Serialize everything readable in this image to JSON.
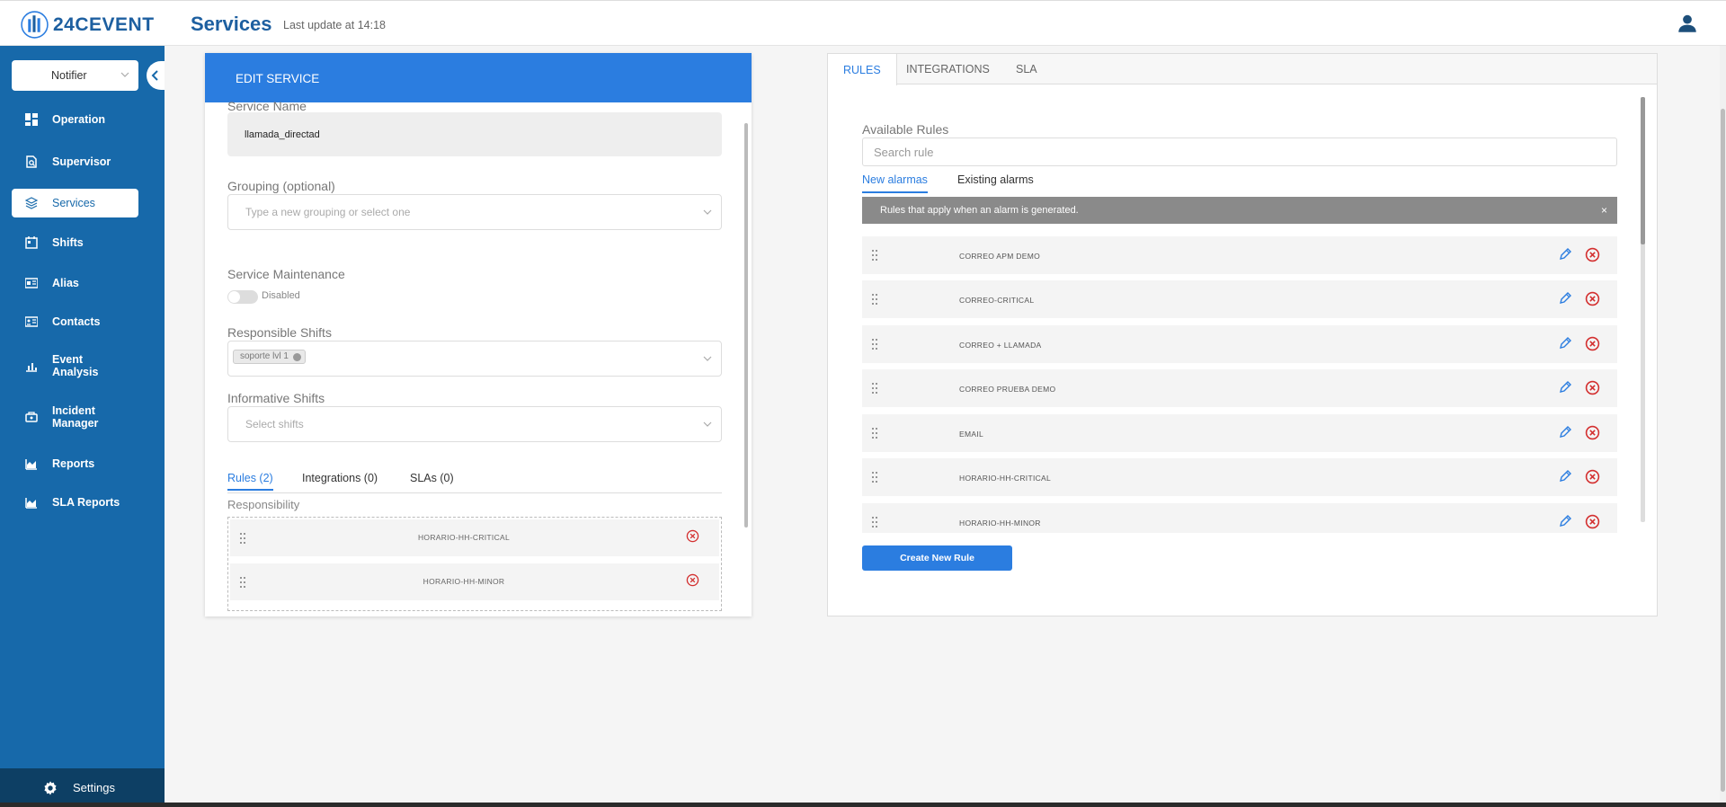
{
  "app": {
    "brand": "24CEVENT",
    "page_title": "Services",
    "last_update": "Last update at 14:18"
  },
  "sidebar": {
    "selector": "Notifier",
    "items": [
      {
        "label": "Operation",
        "icon": "dashboard-icon"
      },
      {
        "label": "Supervisor",
        "icon": "supervisor-icon"
      },
      {
        "label": "Services",
        "icon": "layers-icon",
        "active": true
      },
      {
        "label": "Shifts",
        "icon": "calendar-icon"
      },
      {
        "label": "Alias",
        "icon": "id-card-icon"
      },
      {
        "label": "Contacts",
        "icon": "contact-card-icon"
      },
      {
        "label": "Event Analysis",
        "line1": "Event",
        "line2": "Analysis",
        "icon": "bar-chart-icon"
      },
      {
        "label": "Incident Manager",
        "line1": "Incident",
        "line2": "Manager",
        "icon": "incident-icon"
      },
      {
        "label": "Reports",
        "icon": "area-chart-icon"
      },
      {
        "label": "SLA Reports",
        "icon": "area-chart-icon"
      }
    ],
    "settings": "Settings"
  },
  "edit_service": {
    "header": "EDIT SERVICE",
    "service_name_label": "Service Name",
    "service_name_value": "llamada_directad",
    "grouping_label": "Grouping (optional)",
    "grouping_placeholder": "Type a new grouping or select one",
    "maintenance_label": "Service Maintenance",
    "maintenance_state": "Disabled",
    "responsible_label": "Responsible Shifts",
    "responsible_chip": "soporte lvl 1",
    "informative_label": "Informative Shifts",
    "informative_placeholder": "Select shifts",
    "tabs": [
      "Rules (2)",
      "Integrations (0)",
      "SLAs (0)"
    ],
    "responsibility_label": "Responsibility",
    "assigned_rules": [
      "HORARIO-HH-CRITICAL",
      "HORARIO-HH-MINOR"
    ]
  },
  "rules_panel": {
    "tabs": [
      "RULES",
      "INTEGRATIONS",
      "SLA"
    ],
    "available_label": "Available Rules",
    "search_placeholder": "Search rule",
    "sub_tabs": [
      "New alarmas",
      "Existing alarms"
    ],
    "info_text": "Rules that apply when an alarm is generated.",
    "info_close": "×",
    "rules": [
      "CORREO APM DEMO",
      "CORREO-CRITICAL",
      "CORREO + LLAMADA",
      "CORREO PRUEBA DEMO",
      "EMAIL",
      "HORARIO-HH-CRITICAL",
      "HORARIO-HH-MINOR"
    ],
    "create_button": "Create New Rule"
  },
  "colors": {
    "sidebar": "#1769aa",
    "accent": "#2b7de0",
    "danger": "#d32f2f"
  }
}
